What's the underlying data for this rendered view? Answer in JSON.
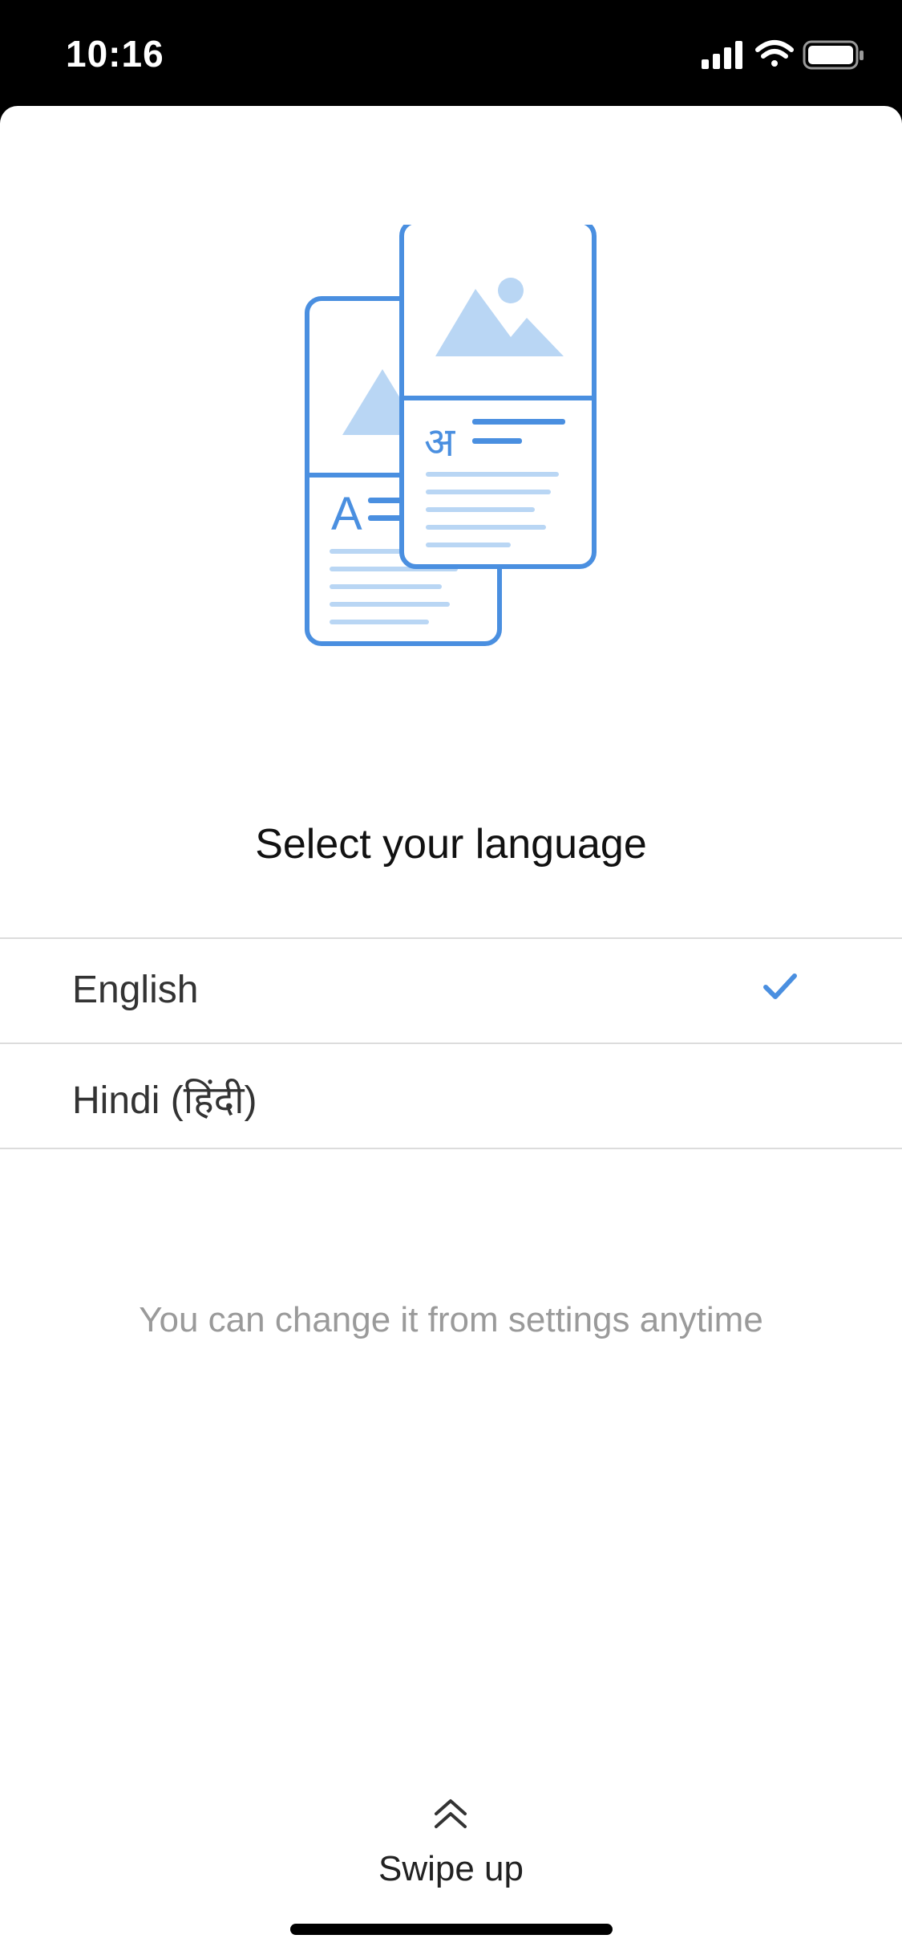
{
  "status_bar": {
    "time": "10:16",
    "icons": [
      "signal-icon",
      "wifi-icon",
      "battery-icon"
    ]
  },
  "illustration": {
    "name": "translated-pages-illustration",
    "back_page_letter": "A",
    "front_page_letter": "अ",
    "colors": {
      "outline": "#4a8fe0",
      "fill": "#b9d6f4"
    }
  },
  "title": "Select your language",
  "languages": [
    {
      "label": "English",
      "selected": true
    },
    {
      "label": "Hindi (हिंदी)",
      "selected": false
    }
  ],
  "hint": "You can change it from settings anytime",
  "footer": {
    "swipe_label": "Swipe up",
    "swipe_icon": "double-chevron-up-icon"
  },
  "colors": {
    "accent": "#4a8fe0",
    "divider": "#dcdcdc",
    "hint_text": "#9a9a9a"
  }
}
